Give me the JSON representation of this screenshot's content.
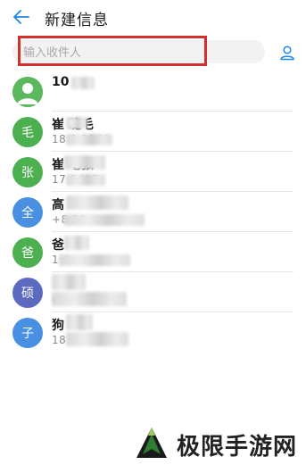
{
  "header": {
    "title": "新建信息",
    "back_icon": "arrow-left-icon"
  },
  "search": {
    "placeholder": "输入收件人",
    "value": "",
    "contact_picker_icon": "person-icon"
  },
  "colors": {
    "accent": "#1e88e5",
    "highlight_border": "#d32f2f",
    "avatar_default_bg": "#4caf50",
    "avatar_green": "#4caf50",
    "avatar_blue": "#4a90e2",
    "avatar_purple": "#5c6bc0"
  },
  "contacts": [
    {
      "avatar": "",
      "avatar_icon": "person-icon",
      "avatar_color": "#4caf50",
      "name": "10",
      "number": ""
    },
    {
      "avatar": "毛",
      "avatar_color": "#4caf50",
      "name": "崔    睫毛",
      "number": "18         3 2842"
    },
    {
      "avatar": "张",
      "avatar_color": "#4caf50",
      "name": "崔      毛张",
      "number": "17         5497"
    },
    {
      "avatar": "全",
      "avatar_color": "#4a90e2",
      "name": "高",
      "number": "+8            90"
    },
    {
      "avatar": "爸",
      "avatar_color": "#4caf50",
      "name": "爸",
      "number": "1             4"
    },
    {
      "avatar": "硕",
      "avatar_color": "#5c6bc0",
      "name": "",
      "number": "            6"
    },
    {
      "avatar": "子",
      "avatar_color": "#4a90e2",
      "name": "狗",
      "number": "18        8  3"
    }
  ],
  "watermark": {
    "text": "极限手游网",
    "logo_icon": "triangle-logo-icon"
  }
}
